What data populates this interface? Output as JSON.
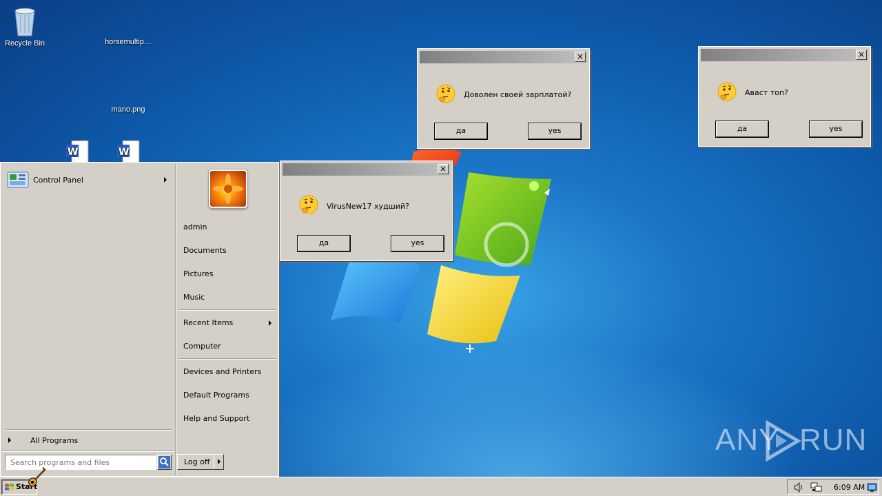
{
  "desktop": {
    "icons": [
      {
        "label": "Recycle Bin",
        "icon": "recycle-bin-icon"
      },
      {
        "label": "horsemultip…",
        "icon": "blank-file-icon"
      },
      {
        "label": "mano.png",
        "icon": "blank-file-icon"
      },
      {
        "label": "",
        "icon": "word-document-icon"
      },
      {
        "label": "",
        "icon": "word-document-icon"
      }
    ],
    "watermark": "ANY RUN"
  },
  "dialogs": [
    {
      "message": "Доволен своей зарплатой?",
      "button_yes_ru": "да",
      "button_yes_en": "yes",
      "close": "×",
      "icon": "thinking-face-icon"
    },
    {
      "message": "Аваст топ?",
      "button_yes_ru": "да",
      "button_yes_en": "yes",
      "close": "×",
      "icon": "thinking-face-icon"
    },
    {
      "message": "VirusNew17 худший?",
      "button_yes_ru": "да",
      "button_yes_en": "yes",
      "close": "×",
      "icon": "thinking-face-icon"
    }
  ],
  "start_menu": {
    "pinned": [
      {
        "label": "Control Panel",
        "icon": "control-panel-icon",
        "has_submenu": true
      }
    ],
    "all_programs": "All Programs",
    "search_placeholder": "Search programs and files",
    "right_items": [
      {
        "label": "admin",
        "has_submenu": false
      },
      {
        "label": "Documents",
        "has_submenu": false
      },
      {
        "label": "Pictures",
        "has_submenu": false
      },
      {
        "label": "Music",
        "has_submenu": false
      },
      {
        "label": "Recent Items",
        "has_submenu": true
      },
      {
        "label": "Computer",
        "has_submenu": false
      },
      {
        "label": "Devices and Printers",
        "has_submenu": false
      },
      {
        "label": "Default Programs",
        "has_submenu": false
      },
      {
        "label": "Help and Support",
        "has_submenu": false
      }
    ],
    "logoff": "Log off"
  },
  "taskbar": {
    "start_label": "Start",
    "clock": "6:09 AM",
    "tray_icons": [
      "speaker-icon",
      "network-icon",
      "show-desktop-icon"
    ]
  }
}
